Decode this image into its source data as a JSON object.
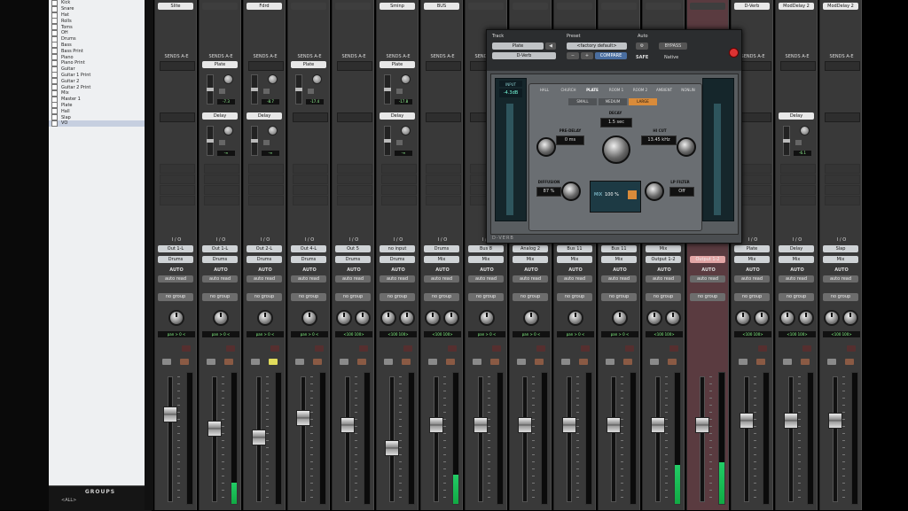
{
  "tracklist": {
    "tracks": [
      "Kick",
      "Snare",
      "Hat",
      "Rolls",
      "Toms",
      "OH",
      "Drums",
      "Bass",
      "Bass Print",
      "Piano",
      "Piano Print",
      "Guitar",
      "Guitar 1 Print",
      "Guitar 2",
      "Guitar 2 Print",
      "Mix",
      "Master 1",
      "Plate",
      "Hall",
      "Slap",
      "VO"
    ],
    "selected": "VO"
  },
  "groups_panel": {
    "title": "GROUPS",
    "row": "<ALL>"
  },
  "sends_header": "SENDS A-E",
  "io_header": "I / O",
  "auto_label": "AUTO",
  "no_group": "no group",
  "strips": [
    {
      "top": "Slite",
      "send1": "",
      "send2": "",
      "inp": "Out 1-L",
      "out": "Drums",
      "auto": "auto read",
      "pan": "pan > 0 <",
      "stereo": false,
      "fader": 0.72,
      "meter": 0.0
    },
    {
      "top": "",
      "send1": "Plate",
      "send2": "Delay",
      "inp": "Out 1-L",
      "out": "Drums",
      "auto": "auto read",
      "pan": "pan > 0 <",
      "stereo": false,
      "fader": 0.58,
      "meter": 0.16,
      "sval1": "-7.3",
      "sval2": "-∞"
    },
    {
      "top": "Fdrd",
      "send1": "",
      "send2": "Delay",
      "inp": "Out 2-L",
      "out": "Drums",
      "auto": "auto read",
      "pan": "pan > 0 <",
      "stereo": false,
      "fader": 0.5,
      "meter": 0.0,
      "sval1": "-8.7",
      "sval2": "-∞"
    },
    {
      "top": "",
      "send1": "Plate",
      "send2": "",
      "inp": "Out 4-L",
      "out": "Drums",
      "auto": "auto read",
      "pan": "pan > 0 <",
      "stereo": false,
      "fader": 0.68,
      "meter": 0.0,
      "sval1": "-17.4",
      "sval2": ""
    },
    {
      "top": "",
      "send1": "",
      "send2": "",
      "inp": "Out 5",
      "out": "Drums",
      "auto": "auto read",
      "pan": "<100 100>",
      "stereo": true,
      "fader": 0.62,
      "meter": 0.0
    },
    {
      "top": "Sminp",
      "send1": "Plate",
      "send2": "Delay",
      "inp": "no input",
      "out": "Drums",
      "auto": "auto read",
      "pan": "<100 100>",
      "stereo": true,
      "fader": 0.4,
      "meter": 0.0,
      "sval1": "-17.8",
      "sval2": "-∞"
    },
    {
      "top": "BUS",
      "send1": "",
      "send2": "",
      "inp": "Drums",
      "out": "Mix",
      "auto": "auto read",
      "pan": "<100 100>",
      "stereo": true,
      "fader": 0.62,
      "meter": 0.22
    },
    {
      "top": "",
      "send1": "",
      "send2": "",
      "inp": "Bus 8",
      "out": "Mix",
      "auto": "auto read",
      "pan": "pan > 0 <",
      "stereo": false,
      "fader": 0.62,
      "meter": 0.0
    },
    {
      "top": "",
      "send1": "",
      "send2": "",
      "inp": "Analog 2",
      "out": "Mix",
      "auto": "auto read",
      "pan": "pan > 0 <",
      "stereo": false,
      "fader": 0.62,
      "meter": 0.0
    },
    {
      "top": "",
      "send1": "",
      "send2": "",
      "inp": "Bus 11",
      "out": "Mix",
      "auto": "auto read",
      "pan": "pan > 0 <",
      "stereo": false,
      "fader": 0.62,
      "meter": 0.0
    },
    {
      "top": "",
      "send1": "",
      "send2": "",
      "inp": "Bus 11",
      "out": "Mix",
      "auto": "auto read",
      "pan": "pan > 0 <",
      "stereo": false,
      "fader": 0.62,
      "meter": 0.0
    },
    {
      "top": "",
      "send1": "",
      "send2": "",
      "inp": "Mix",
      "out": "Output 1-2",
      "auto": "auto read",
      "pan": "<100 100>",
      "stereo": true,
      "fader": 0.62,
      "meter": 0.3
    },
    {
      "top": "",
      "send1": "",
      "send2": "",
      "inp": "",
      "out": "Output 1-2",
      "auto": "auto read",
      "pan": "",
      "stereo": false,
      "vca": true,
      "fader": 0.62,
      "meter": 0.32
    },
    {
      "top": "D-Verb",
      "send1": "",
      "send2": "",
      "inp": "Plate",
      "out": "Mix",
      "auto": "auto read",
      "pan": "<100 100>",
      "stereo": true,
      "fader": 0.66,
      "meter": 0.0
    },
    {
      "top": "ModDelay 2",
      "send1": "",
      "send2": "Delay",
      "inp": "Delay",
      "out": "Mix",
      "auto": "auto read",
      "pan": "<100 100>",
      "stereo": true,
      "fader": 0.66,
      "meter": 0.0,
      "sval2": "-6.1"
    },
    {
      "top": "ModDelay 2",
      "send1": "",
      "send2": "",
      "inp": "Slap",
      "out": "Mix",
      "auto": "auto read",
      "pan": "<100 100>",
      "stereo": true,
      "fader": 0.66,
      "meter": 0.0
    }
  ],
  "plugin": {
    "track_label": "Track",
    "preset_label": "Preset",
    "auto_label": "Auto",
    "track_name": "Plate",
    "track_sub": "D-Verb",
    "preset_name": "<factory default>",
    "compare": "COMPARE",
    "bypass": "BYPASS",
    "safe": "SAFE",
    "native": "Native",
    "input_label": "INPUT",
    "input_val": "-4.3dB",
    "algorithms": [
      "HALL",
      "CHURCH",
      "PLATE",
      "ROOM 1",
      "ROOM 2",
      "AMBIENT",
      "NONLIN"
    ],
    "sizes": [
      "SMALL",
      "MEDIUM",
      "LARGE"
    ],
    "decay_label": "DECAY",
    "decay_val": "1.5 sec",
    "predelay_label": "PRE-DELAY",
    "predelay_val": "0 ms",
    "hicut_label": "HI CUT",
    "hicut_val": "13.45 kHz",
    "diffusion_label": "DIFFUSION",
    "diffusion_val": "87 %",
    "lpfilter_label": "LP FILTER",
    "lpfilter_val": "Off",
    "mix_label": "MIX",
    "mix_val": "100 %",
    "footer": "D-VERB"
  }
}
